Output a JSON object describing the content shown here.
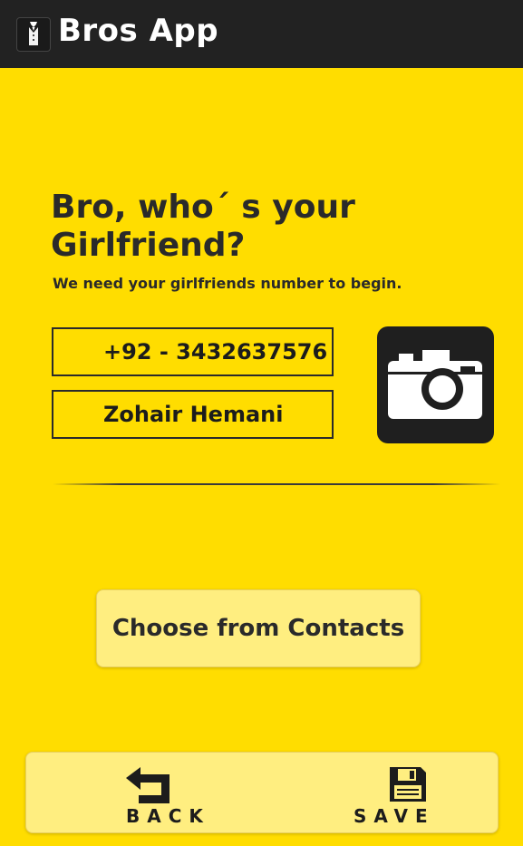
{
  "app_bar": {
    "title": "Bros App",
    "icon": "tuxedo-icon",
    "background": "#222222"
  },
  "prompt": {
    "headline": "Bro, who´ s your Girlfriend?",
    "subline": "We need your girlfriends number to begin."
  },
  "form": {
    "phone_value": "+92 - 3432637576",
    "name_value": "Zohair Hemani"
  },
  "camera": {
    "icon": "camera-icon"
  },
  "contacts_button": {
    "label": "Choose from Contacts"
  },
  "bottom_nav": {
    "back_label": "BACK",
    "back_icon": "back-arrow-icon",
    "save_label": "SAVE",
    "save_icon": "floppy-disk-icon"
  },
  "colors": {
    "background": "#FFDD00",
    "button_bg": "#FFEE80",
    "text": "#2A2A2A"
  }
}
